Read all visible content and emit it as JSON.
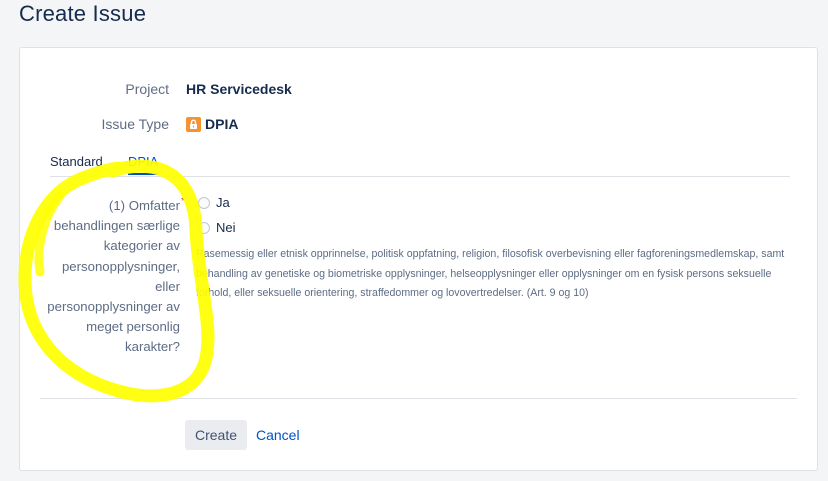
{
  "page": {
    "title": "Create Issue"
  },
  "form": {
    "project_label": "Project",
    "project_value": "HR Servicedesk",
    "issue_type_label": "Issue Type",
    "issue_type_value": "DPIA",
    "issue_type_icon": "lock-icon",
    "issue_type_icon_color": "#f79232"
  },
  "tabs": [
    {
      "label": "Standard",
      "active": false
    },
    {
      "label": "DPIA",
      "active": true
    }
  ],
  "question": {
    "label": "(1) Omfatter behandlingen særlige kategorier av personopplysninger, eller personopplysninger av meget personlig karakter?",
    "required_marker": "*",
    "options": [
      {
        "label": "Ja",
        "selected": false
      },
      {
        "label": "Nei",
        "selected": false
      }
    ],
    "help_text": "Rasemessig eller etnisk opprinnelse, politisk oppfatning, religion, filosofisk overbevisning eller fagforeningsmedlemskap, samt behandling av genetiske og biometriske opplysninger, helseopplysninger eller opplysninger om en fysisk persons seksuelle forhold, eller seksuelle orientering, straffedommer og lovovertredelser. (Art. 9 og 10)"
  },
  "actions": {
    "create_label": "Create",
    "cancel_label": "Cancel"
  },
  "colors": {
    "accent": "#0052cc",
    "highlight": "#ffff00"
  }
}
